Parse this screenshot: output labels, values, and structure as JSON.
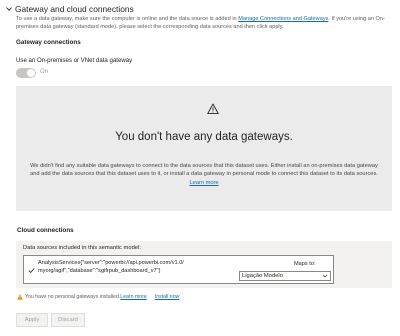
{
  "header": {
    "title": "Gateway and cloud connections",
    "icon": "chevron-down-icon"
  },
  "intro": {
    "before_link": "To use a data gateway, make sure the computer is online and the data source is added in ",
    "link": "Manage Connections and Gateways",
    "after_link": ". If you're using an On-premises data gateway (standard mode), please select the corresponding data sources and then click apply."
  },
  "gateway_connections": {
    "heading": "Gateway connections",
    "onprem_label": "Use an On-premises or VNet data gateway",
    "toggle_text": "On",
    "toggle_state": "on-disabled"
  },
  "empty_state": {
    "icon": "warning-icon",
    "title": "You don't have any data gateways.",
    "body": "We didn't find any suitable data gateways to connect to the data sources that this dataset uses. Either install an on-premises data gateway and add the data sources that this dataset uses to it, or install a data gateway in personal mode to connect this dataset to its data sources.",
    "link": "Learn more"
  },
  "cloud_connections": {
    "heading": "Cloud connections",
    "sources_label": "Data sources included in this semantic model:",
    "source_line1": "AnalysisServices{\"server\":\"powerbi://api.powerbi.com/v1.0/",
    "source_line2": "myorg/agif\",\"database\":\"sgifrpub_dashboard_v7\"}",
    "maps_to_label": "Maps to:",
    "maps_to_value": "Ligação Modelo"
  },
  "notice": {
    "text": "You have no personal gateways installed.",
    "learn_more": "Learn more",
    "install_now": "Install now"
  },
  "buttons": {
    "apply": "Apply",
    "discard": "Discard"
  },
  "colors": {
    "link": "#0f6cbd",
    "warning": "#d29200",
    "panel_bg": "#ebebeb"
  }
}
